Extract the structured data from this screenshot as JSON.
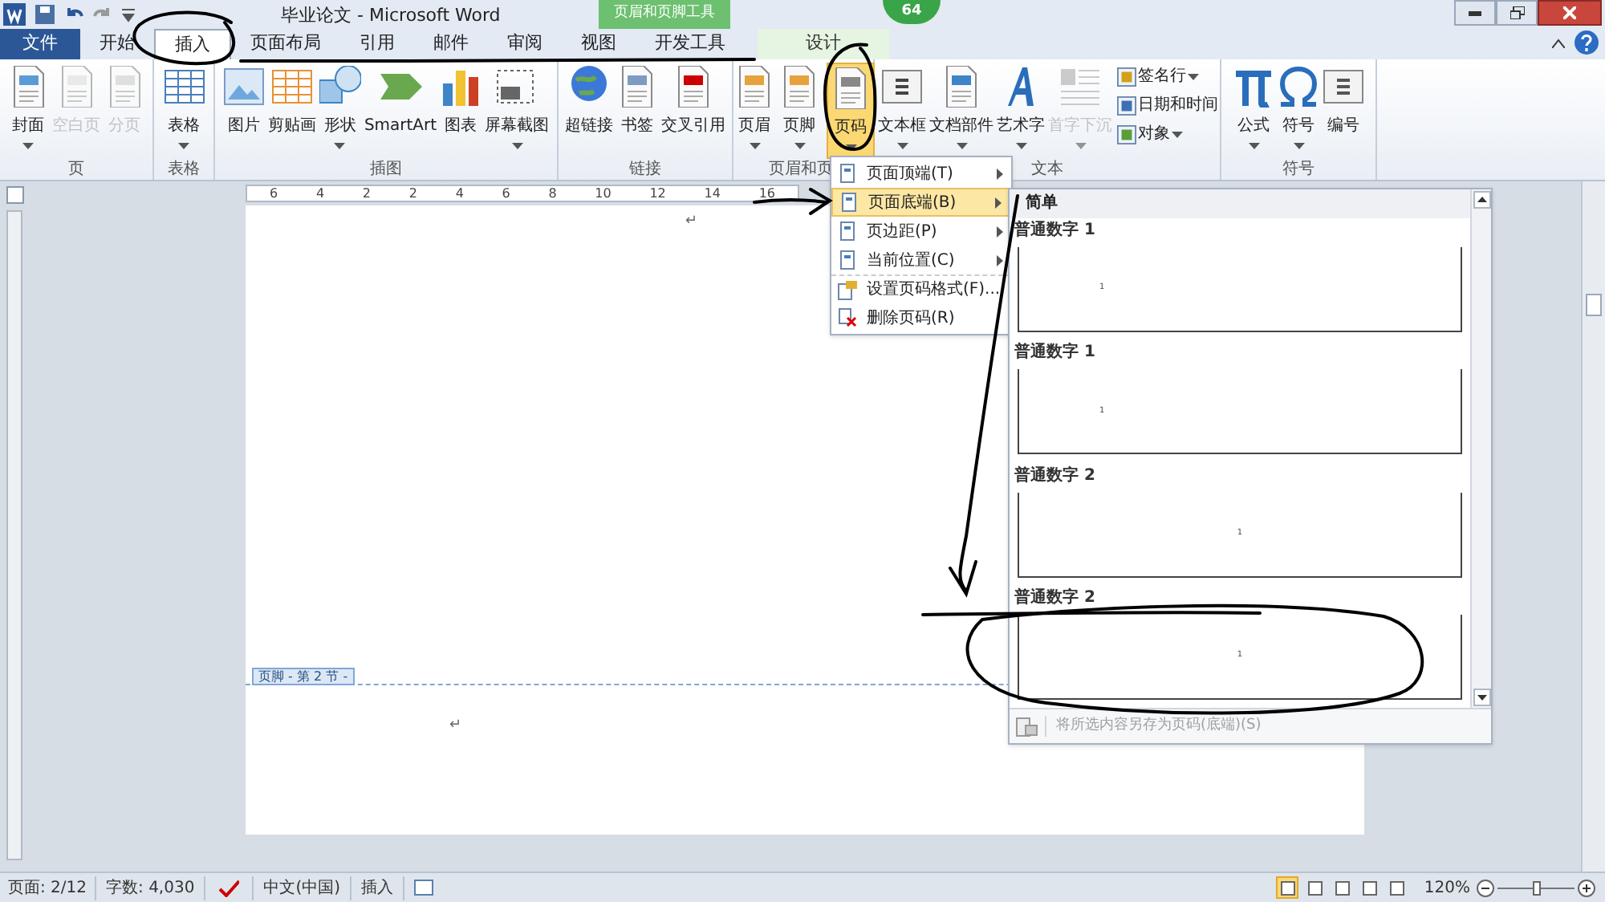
{
  "title_bar": {
    "title": "毕业论文 - Microsoft Word",
    "badge": "64"
  },
  "contextual_tab_group": {
    "label": "页眉和页脚工具"
  },
  "tabs": [
    {
      "label": "文件",
      "kind": "file",
      "selected": false
    },
    {
      "label": "开始",
      "kind": "normal",
      "selected": false
    },
    {
      "label": "插入",
      "kind": "normal",
      "selected": true
    },
    {
      "label": "页面布局",
      "kind": "normal",
      "selected": false
    },
    {
      "label": "引用",
      "kind": "normal",
      "selected": false
    },
    {
      "label": "邮件",
      "kind": "normal",
      "selected": false
    },
    {
      "label": "审阅",
      "kind": "normal",
      "selected": false
    },
    {
      "label": "视图",
      "kind": "normal",
      "selected": false
    },
    {
      "label": "开发工具",
      "kind": "normal",
      "selected": false
    },
    {
      "label": "设计",
      "kind": "contextual",
      "selected": false
    }
  ],
  "ribbon_groups": [
    {
      "label": "页",
      "buttons": [
        {
          "label": "封面",
          "dropdown": true,
          "disabled": false,
          "selected": false
        },
        {
          "label": "空白页",
          "dropdown": false,
          "disabled": true,
          "selected": false
        },
        {
          "label": "分页",
          "dropdown": false,
          "disabled": true,
          "selected": false
        }
      ]
    },
    {
      "label": "表格",
      "buttons": [
        {
          "label": "表格",
          "dropdown": true,
          "disabled": false,
          "selected": false
        }
      ]
    },
    {
      "label": "插图",
      "buttons": [
        {
          "label": "图片",
          "dropdown": false,
          "disabled": false,
          "selected": false
        },
        {
          "label": "剪贴画",
          "dropdown": false,
          "disabled": false,
          "selected": false
        },
        {
          "label": "形状",
          "dropdown": true,
          "disabled": false,
          "selected": false
        },
        {
          "label": "SmartArt",
          "dropdown": false,
          "disabled": false,
          "selected": false
        },
        {
          "label": "图表",
          "dropdown": false,
          "disabled": false,
          "selected": false
        },
        {
          "label": "屏幕截图",
          "dropdown": true,
          "disabled": false,
          "selected": false
        }
      ]
    },
    {
      "label": "链接",
      "buttons": [
        {
          "label": "超链接",
          "dropdown": false,
          "disabled": false,
          "selected": false
        },
        {
          "label": "书签",
          "dropdown": false,
          "disabled": false,
          "selected": false
        },
        {
          "label": "交叉引用",
          "dropdown": false,
          "disabled": false,
          "selected": false
        }
      ]
    },
    {
      "label": "页眉和页",
      "buttons": [
        {
          "label": "页眉",
          "dropdown": true,
          "disabled": false,
          "selected": false
        },
        {
          "label": "页脚",
          "dropdown": true,
          "disabled": false,
          "selected": false
        },
        {
          "label": "页码",
          "dropdown": true,
          "disabled": false,
          "selected": true
        }
      ]
    },
    {
      "label": "文本",
      "buttons": [
        {
          "label": "文本框",
          "dropdown": true,
          "disabled": false,
          "selected": false
        },
        {
          "label": "文档部件",
          "dropdown": true,
          "disabled": false,
          "selected": false
        },
        {
          "label": "艺术字",
          "dropdown": true,
          "disabled": false,
          "selected": false
        },
        {
          "label": "首字下沉",
          "dropdown": true,
          "disabled": true,
          "selected": false
        }
      ],
      "small_buttons": [
        {
          "label": "签名行",
          "dropdown": true
        },
        {
          "label": "日期和时间",
          "dropdown": false
        },
        {
          "label": "对象",
          "dropdown": true
        }
      ]
    },
    {
      "label": "符号",
      "buttons": [
        {
          "label": "公式",
          "dropdown": true,
          "disabled": false,
          "selected": false
        },
        {
          "label": "符号",
          "dropdown": true,
          "disabled": false,
          "selected": false
        },
        {
          "label": "编号",
          "dropdown": false,
          "disabled": false,
          "selected": false
        }
      ]
    }
  ],
  "ruler": {
    "labels": [
      "6",
      "4",
      "2",
      "2",
      "4",
      "6",
      "8",
      "10",
      "12",
      "14",
      "16"
    ]
  },
  "document": {
    "paragraph_marks": [
      "↵",
      "↵"
    ],
    "footer_label": "页脚 - 第 2 节 -"
  },
  "page_number_menu": {
    "items": [
      {
        "label": "页面顶端(T)",
        "kind": "submenu",
        "selected": false
      },
      {
        "label": "页面底端(B)",
        "kind": "submenu",
        "selected": true
      },
      {
        "label": "页边距(P)",
        "kind": "submenu",
        "selected": false
      },
      {
        "label": "当前位置(C)",
        "kind": "submenu",
        "selected": false
      },
      {
        "label": "设置页码格式(F)...",
        "kind": "format",
        "selected": false
      },
      {
        "label": "删除页码(R)",
        "kind": "remove",
        "selected": false
      }
    ]
  },
  "gallery": {
    "header": "简单",
    "entries": [
      {
        "title": "普通数字 1",
        "number": "1",
        "kind": "left"
      },
      {
        "title": "普通数字 1",
        "number": "1",
        "kind": "left"
      },
      {
        "title": "普通数字 2",
        "number": "1",
        "kind": "center"
      },
      {
        "title": "普通数字 2",
        "number": "1",
        "kind": "center"
      }
    ],
    "footer": {
      "label": "将所选内容另存为页码(底端)(S)",
      "disabled": true
    }
  },
  "status_bar": {
    "page": "页面: 2/12",
    "words": "字数: 4,030",
    "language": "中文(中国)",
    "mode": "插入",
    "views": [
      {
        "selected": true
      },
      {
        "selected": false
      },
      {
        "selected": false
      },
      {
        "selected": false
      },
      {
        "selected": false
      }
    ],
    "zoom": "120%",
    "zoom_slider": {
      "level": 0.5
    }
  }
}
